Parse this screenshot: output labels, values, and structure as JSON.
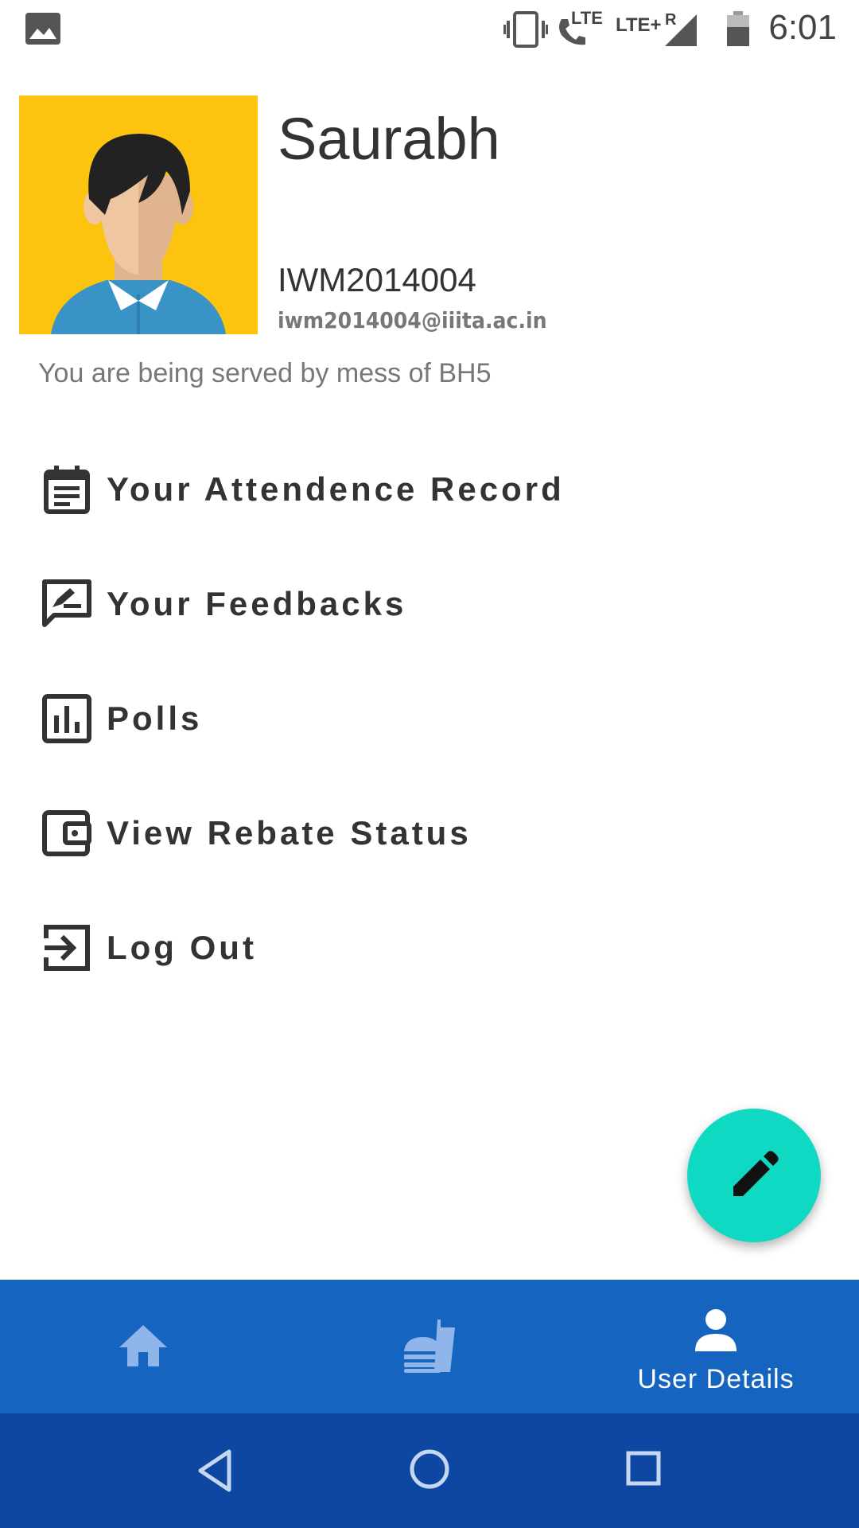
{
  "status_bar": {
    "time": "6:01",
    "network_label_1": "LTE",
    "network_label_2": "LTE+",
    "roaming_label": "R",
    "icons": [
      "image-icon",
      "vibrate-icon",
      "volte-call-icon",
      "signal-icon",
      "battery-icon"
    ]
  },
  "profile": {
    "name": "Saurabh",
    "id": "IWM2014004",
    "email": "iwm2014004@iiita.ac.in",
    "mess_text": "You are being served by mess of BH5",
    "avatar_icon": "avatar-icon"
  },
  "menu": {
    "items": [
      {
        "label": "Your Attendence Record",
        "icon": "calendar-note-icon"
      },
      {
        "label": "Your Feedbacks",
        "icon": "feedback-icon"
      },
      {
        "label": "Polls",
        "icon": "poll-icon"
      },
      {
        "label": "View Rebate Status",
        "icon": "wallet-icon"
      },
      {
        "label": "Log Out",
        "icon": "logout-icon"
      }
    ]
  },
  "fab": {
    "icon": "edit-pencil-icon"
  },
  "bottom_nav": {
    "items": [
      {
        "icon": "home-icon",
        "label": ""
      },
      {
        "icon": "fastfood-icon",
        "label": ""
      },
      {
        "icon": "person-icon",
        "label": "User Details"
      }
    ],
    "active_index": 2
  },
  "system_nav": {
    "icons": [
      "back-icon",
      "home-circle-icon",
      "recents-icon"
    ]
  },
  "colors": {
    "accent": "#10d9c3",
    "primary": "#1565c0",
    "primary_dark": "#0d47a1",
    "avatar_bg": "#fcc30f"
  }
}
